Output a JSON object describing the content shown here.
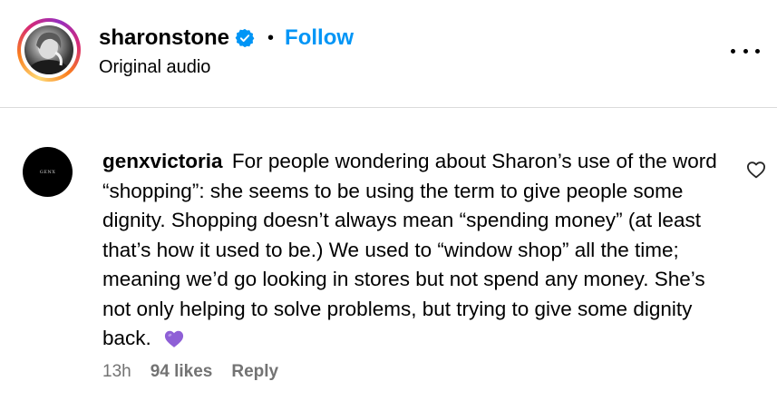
{
  "post": {
    "username": "sharonstone",
    "separator": "•",
    "follow_label": "Follow",
    "audio_label": "Original audio",
    "avatar_icon": "user-photo-icon",
    "verified_icon": "verified-badge-icon",
    "more_icon": "more-options-icon"
  },
  "comment": {
    "username": "genxvictoria",
    "text": "For people wondering about Sharon’s use of the word “shopping”: she seems to be using the term to give people some dignity. Shopping doesn’t always mean “spending money” (at least that’s how it used to be.) We used to “window shop” all the time; meaning we’d go looking in stores but not spend any money. She’s not only helping to solve problems, but trying to give some dignity back.",
    "emoji_icon": "purple-heart-emoji-icon",
    "avatar_text": "GENX",
    "time": "13h",
    "likes": "94 likes",
    "reply_label": "Reply",
    "like_icon": "heart-outline-icon"
  },
  "colors": {
    "accent": "#0095f6",
    "meta_text": "#737373",
    "divider": "#dbdbdb",
    "emoji": "#8e5fd6"
  }
}
